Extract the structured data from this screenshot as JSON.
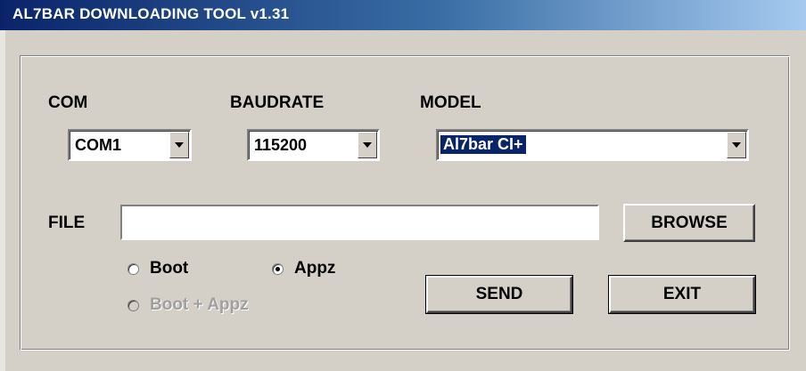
{
  "window": {
    "title": "AL7BAR DOWNLOADING TOOL v1.31"
  },
  "com": {
    "label": "COM",
    "value": "COM1"
  },
  "baudrate": {
    "label": "BAUDRATE",
    "value": "115200"
  },
  "model": {
    "label": "MODEL",
    "value": "Al7bar CI+"
  },
  "file": {
    "label": "FILE",
    "value": ""
  },
  "buttons": {
    "browse": "BROWSE",
    "send": "SEND",
    "exit": "EXIT"
  },
  "radios": {
    "boot": {
      "label": "Boot",
      "checked": false
    },
    "appz": {
      "label": "Appz",
      "checked": true
    },
    "boot_appz": {
      "label": "Boot + Appz",
      "checked": false,
      "enabled": false
    }
  },
  "icons": {
    "dropdown": "chevron-down-icon"
  }
}
